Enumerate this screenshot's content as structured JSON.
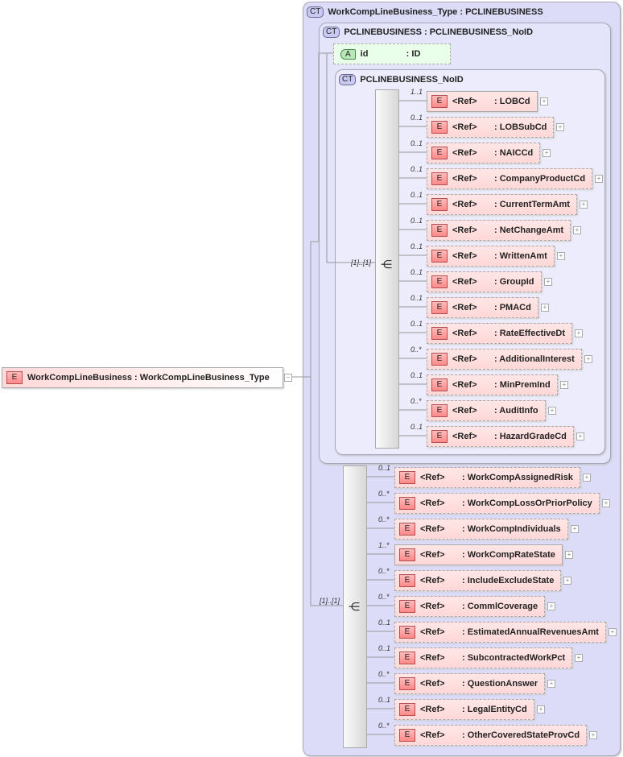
{
  "root": {
    "icon": "E",
    "label": "WorkCompLineBusiness : WorkCompLineBusiness_Type"
  },
  "outer": {
    "badge": "CT",
    "title": "WorkCompLineBusiness_Type : PCLINEBUSINESS"
  },
  "inner": {
    "badge": "CT",
    "title": "PCLINEBUSINESS : PCLINEBUSINESS_NoID"
  },
  "attribute": {
    "badge": "A",
    "name": "id",
    "type": ": ID"
  },
  "noid": {
    "badge": "CT",
    "title": "PCLINEBUSINESS_NoID"
  },
  "seq1": {
    "mult": "[1]..[1]"
  },
  "seq2": {
    "mult": "[1]..[1]"
  },
  "ref_label": "<Ref>",
  "group1": [
    {
      "mult": "1..1",
      "name": ": LOBCd"
    },
    {
      "mult": "0..1",
      "name": ": LOBSubCd"
    },
    {
      "mult": "0..1",
      "name": ": NAICCd"
    },
    {
      "mult": "0..1",
      "name": ": CompanyProductCd"
    },
    {
      "mult": "0..1",
      "name": ": CurrentTermAmt"
    },
    {
      "mult": "0..1",
      "name": ": NetChangeAmt"
    },
    {
      "mult": "0..1",
      "name": ": WrittenAmt"
    },
    {
      "mult": "0..1",
      "name": ": GroupId"
    },
    {
      "mult": "0..1",
      "name": ": PMACd"
    },
    {
      "mult": "0..1",
      "name": ": RateEffectiveDt"
    },
    {
      "mult": "0..*",
      "name": ": AdditionalInterest"
    },
    {
      "mult": "0..1",
      "name": ": MinPremInd"
    },
    {
      "mult": "0..*",
      "name": ": AuditInfo"
    },
    {
      "mult": "0..1",
      "name": ": HazardGradeCd"
    }
  ],
  "group2": [
    {
      "mult": "0..1",
      "name": ": WorkCompAssignedRisk"
    },
    {
      "mult": "0..*",
      "name": ": WorkCompLossOrPriorPolicy"
    },
    {
      "mult": "0..*",
      "name": ": WorkCompIndividuals"
    },
    {
      "mult": "1..*",
      "name": ": WorkCompRateState"
    },
    {
      "mult": "0..*",
      "name": ": IncludeExcludeState"
    },
    {
      "mult": "0..*",
      "name": ": CommlCoverage"
    },
    {
      "mult": "0..1",
      "name": ": EstimatedAnnualRevenuesAmt"
    },
    {
      "mult": "0..1",
      "name": ": SubcontractedWorkPct"
    },
    {
      "mult": "0..*",
      "name": ": QuestionAnswer"
    },
    {
      "mult": "0..1",
      "name": ": LegalEntityCd"
    },
    {
      "mult": "0..*",
      "name": ": OtherCoveredStateProvCd"
    }
  ]
}
